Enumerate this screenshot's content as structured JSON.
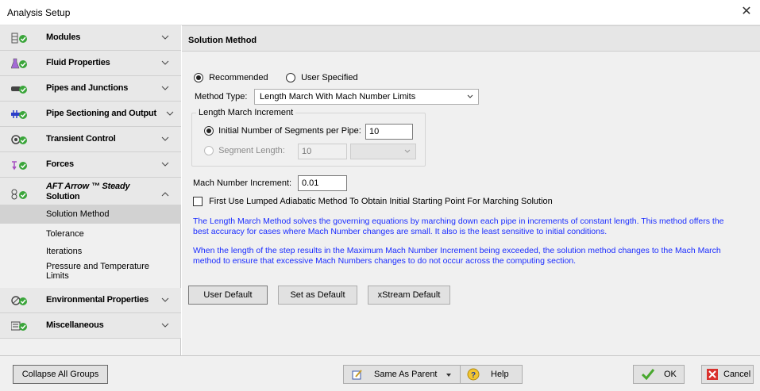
{
  "window": {
    "title": "Analysis Setup",
    "close_glyph": "✕"
  },
  "sidebar": {
    "groups": [
      {
        "label": "Modules",
        "icon": "modules-icon"
      },
      {
        "label": "Fluid Properties",
        "icon": "fluid-properties-icon"
      },
      {
        "label": "Pipes and Junctions",
        "icon": "pipes-junctions-icon"
      },
      {
        "label": "Pipe Sectioning and Output",
        "icon": "pipe-sectioning-icon"
      },
      {
        "label": "Transient Control",
        "icon": "transient-control-icon"
      },
      {
        "label": "Forces",
        "icon": "forces-icon"
      },
      {
        "label_line1": "AFT Arrow ™ Steady",
        "label_line2": "Solution",
        "icon": "steady-solution-icon"
      },
      {
        "label": "Environmental Properties",
        "icon": "environmental-icon"
      },
      {
        "label": "Miscellaneous",
        "icon": "miscellaneous-icon"
      }
    ],
    "sub_items": [
      {
        "label": "Solution Method"
      },
      {
        "label": "Tolerance"
      },
      {
        "label": "Iterations"
      },
      {
        "label_line1": "Pressure and Temperature",
        "label_line2": "Limits"
      }
    ]
  },
  "main": {
    "header": "Solution Method",
    "radio_recommended": "Recommended",
    "radio_user_specified": "User Specified",
    "method_type_label": "Method Type:",
    "method_type_value": "Length March With Mach Number Limits",
    "length_march_legend": "Length March Increment",
    "initial_segments_label": "Initial Number of Segments per Pipe:",
    "initial_segments_value": "10",
    "segment_length_label": "Segment Length:",
    "segment_length_value": "10",
    "mach_increment_label": "Mach Number Increment:",
    "mach_increment_value": "0.01",
    "lumped_checkbox_label": "First Use Lumped Adiabatic Method To Obtain Initial Starting Point For Marching Solution",
    "info1": "The Length March Method solves the governing equations by marching down each pipe in increments of constant length. This method offers the best accuracy for cases where Mach Number changes are small. It also is the least sensitive to initial conditions.",
    "info2": "When the length of the step results in the Maximum Mach Number Increment being exceeded, the solution method changes to the Mach March method to ensure that excessive Mach Numbers changes to do not occur across the computing section.",
    "btn_user_default": "User Default",
    "btn_set_default": "Set as Default",
    "btn_xstream_default": "xStream Default"
  },
  "footer": {
    "collapse_all": "Collapse All Groups",
    "same_as_parent": "Same As Parent",
    "help": "Help",
    "ok": "OK",
    "cancel": "Cancel"
  },
  "colors": {
    "icon_green": "#3aa53a",
    "info_blue": "#1a2cff",
    "cancel_red": "#d9302c"
  }
}
